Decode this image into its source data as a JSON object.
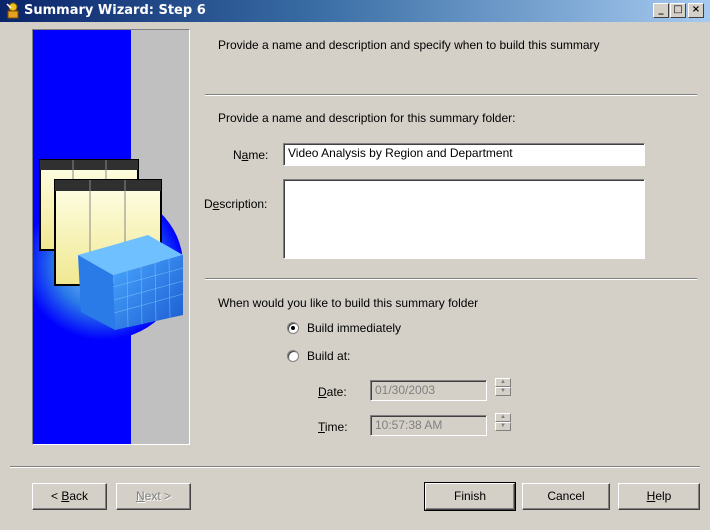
{
  "window": {
    "title": "Summary Wizard: Step 6",
    "controls": [
      "_",
      "□",
      "×"
    ]
  },
  "header": {
    "instruction": "Provide a name and description and specify when to build this summary"
  },
  "name_section": {
    "heading": "Provide a name and description for this summary folder:",
    "name_label_pre": "N",
    "name_label_u": "a",
    "name_label_post": "me:",
    "name_value": "Video Analysis by Region and Department",
    "description_label_pre": "D",
    "description_label_u": "e",
    "description_label_post": "scription:",
    "description_value": ""
  },
  "build_section": {
    "question": "When would you like to build this summary folder",
    "options": [
      {
        "label": "Build immediately",
        "selected": true
      },
      {
        "label": "Build at:",
        "selected": false
      }
    ],
    "date_label_u": "D",
    "date_label_post": "ate:",
    "date_value": "01/30/2003",
    "time_label_u": "T",
    "time_label_post": "ime:",
    "time_value": "10:57:38 AM"
  },
  "buttons": {
    "back_pre": "< ",
    "back_u": "B",
    "back_post": "ack",
    "next_pre": "",
    "next_u": "N",
    "next_post": "ext >",
    "finish": "Finish",
    "cancel": "Cancel",
    "help_u": "H",
    "help_post": "elp"
  },
  "colors": {
    "titlebar_start": "#0a246a",
    "titlebar_end": "#a6caf0",
    "graphic_blue": "#0000ff",
    "dialog_gray": "#d4d0c8"
  }
}
